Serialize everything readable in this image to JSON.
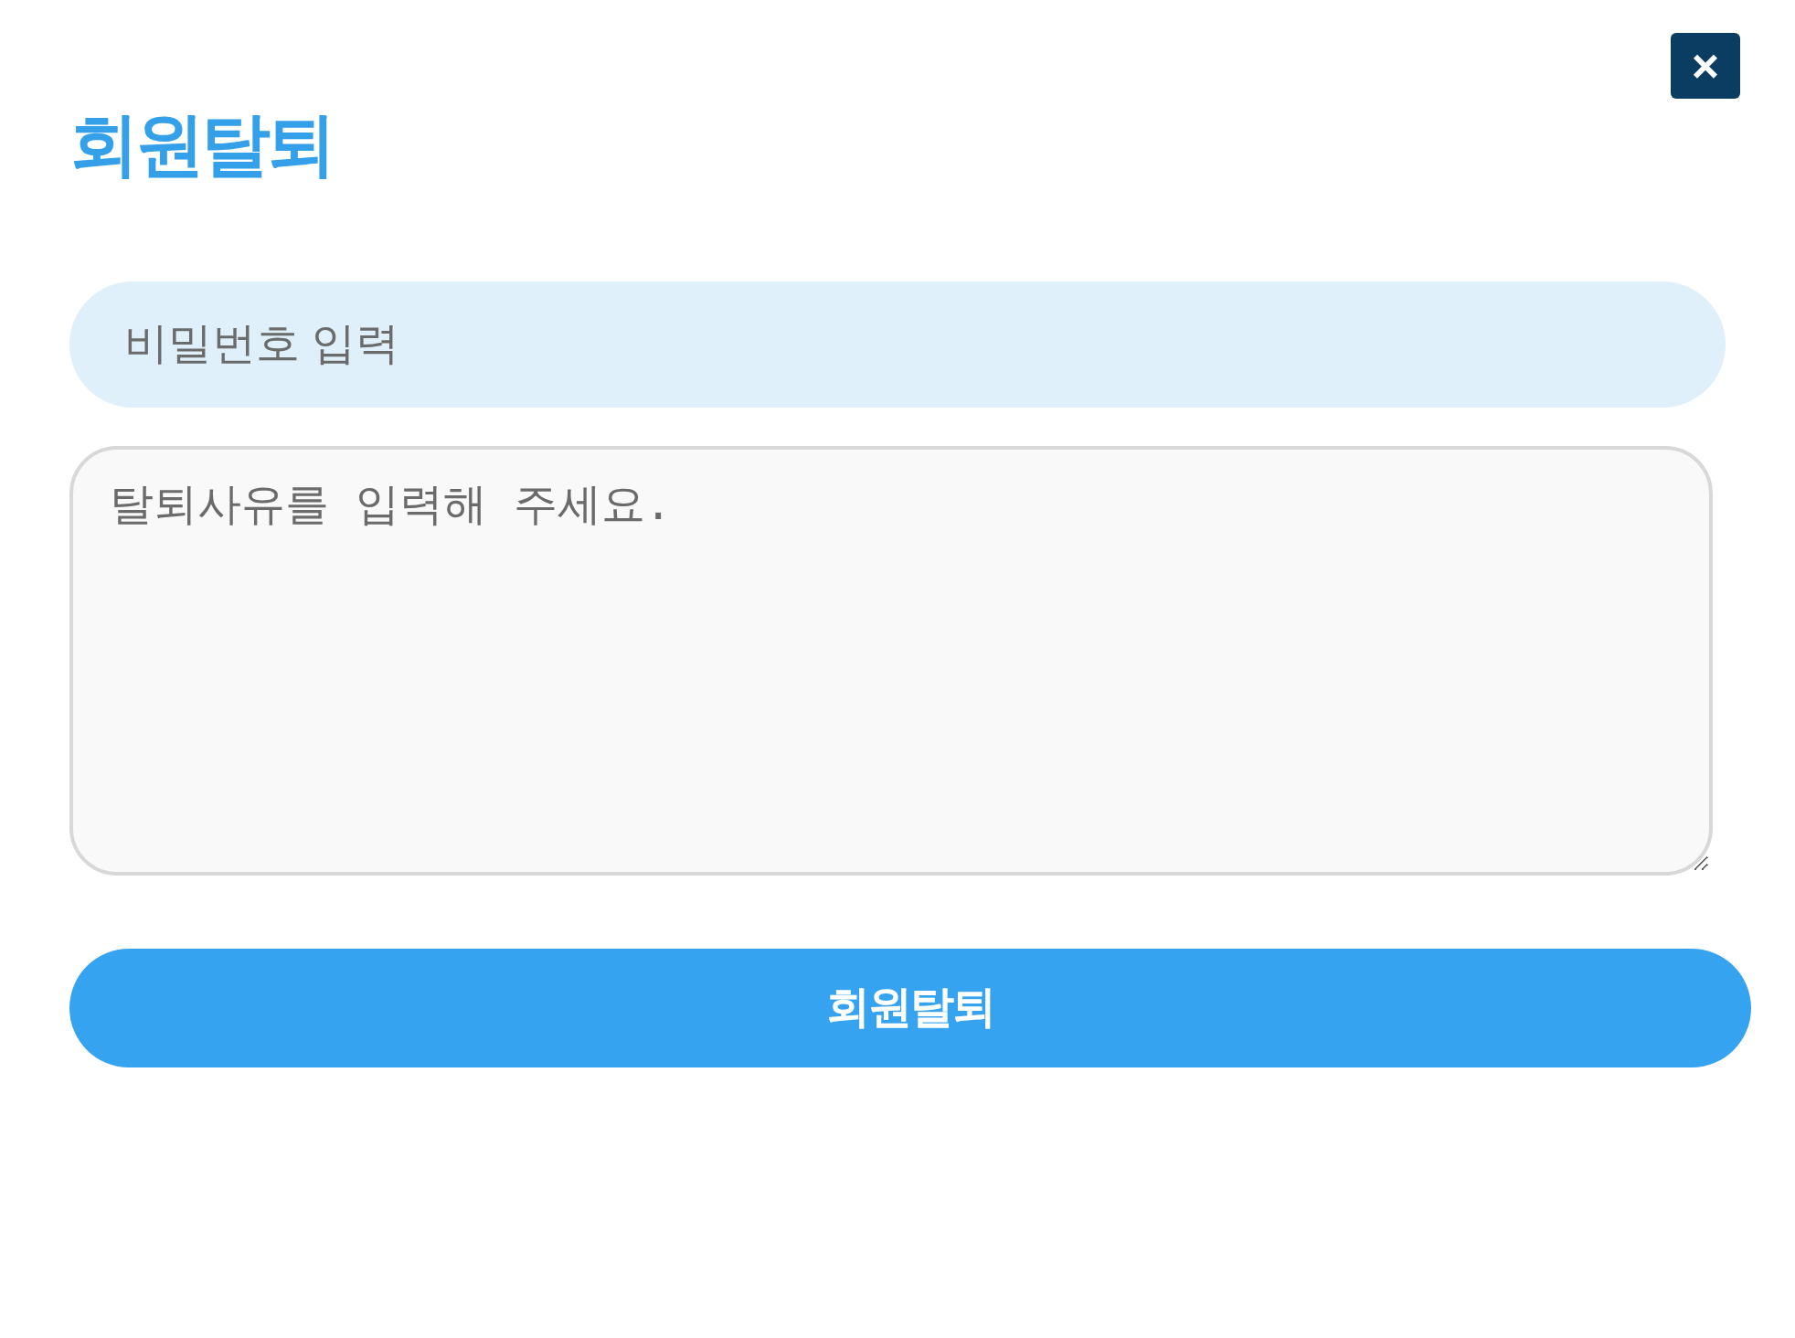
{
  "dialog": {
    "close": "×",
    "title": "회원탈퇴"
  },
  "password": {
    "placeholder": "비밀번호 입력"
  },
  "reason": {
    "placeholder": "탈퇴사유를 입력해 주세요."
  },
  "submit": {
    "label": "회원탈퇴"
  }
}
